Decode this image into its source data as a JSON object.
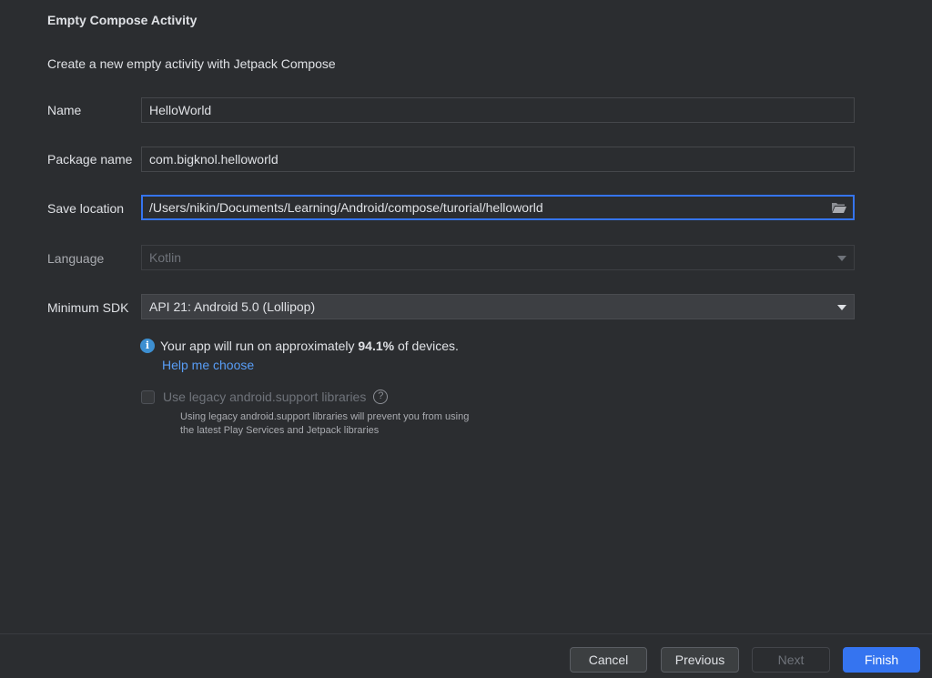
{
  "dialog": {
    "title": "Empty Compose Activity",
    "subtitle": "Create a new empty activity with Jetpack Compose"
  },
  "form": {
    "name": {
      "label": "Name",
      "value": "HelloWorld"
    },
    "package": {
      "label": "Package name",
      "value": "com.bigknol.helloworld"
    },
    "location": {
      "label": "Save location",
      "value": "/Users/nikin/Documents/Learning/Android/compose/turorial/helloworld",
      "icon": "folder-icon"
    },
    "language": {
      "label": "Language",
      "value": "Kotlin"
    },
    "min_sdk": {
      "label": "Minimum SDK",
      "value": "API 21: Android 5.0 (Lollipop)"
    }
  },
  "info": {
    "prefix": "Your app will run on approximately",
    "percent": "94.1%",
    "suffix": "of devices.",
    "help_link": "Help me choose"
  },
  "legacy": {
    "label": "Use legacy android.support libraries",
    "checked": false,
    "desc_line1": "Using legacy android.support libraries will prevent you from using",
    "desc_line2": "the latest Play Services and Jetpack libraries"
  },
  "buttons": {
    "cancel": "Cancel",
    "previous": "Previous",
    "next": "Next",
    "finish": "Finish"
  },
  "colors": {
    "background": "#2b2d30",
    "accent": "#3574f0",
    "link": "#589df6",
    "info": "#3d8fd1"
  }
}
